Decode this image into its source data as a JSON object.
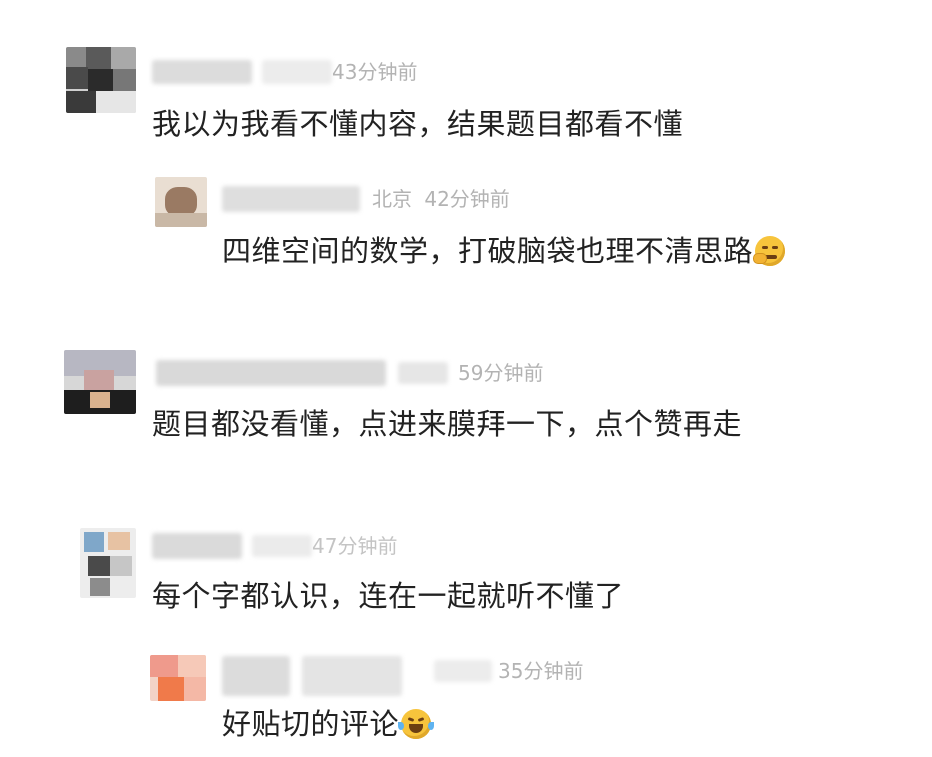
{
  "comments": [
    {
      "time": "43分钟前",
      "text": "我以为我看不懂内容，结果题目都看不懂"
    },
    {
      "location": "北京",
      "time": "42分钟前",
      "text": "四维空间的数学，打破脑袋也理不清思路",
      "emoji": "thinking-hand-emoji"
    },
    {
      "time": "59分钟前",
      "text": "题目都没看懂，点进来膜拜一下，点个赞再走"
    },
    {
      "time": "47分钟前",
      "text": "每个字都认识，连在一起就听不懂了"
    },
    {
      "time": "35分钟前",
      "text": "好贴切的评论",
      "emoji": "laughing-tears-emoji"
    }
  ]
}
